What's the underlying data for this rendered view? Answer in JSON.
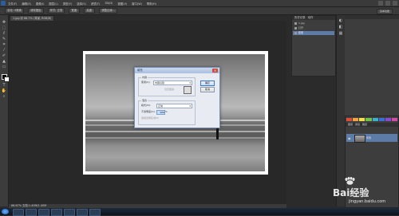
{
  "menubar": {
    "items": [
      "文件(F)",
      "编辑(E)",
      "图像(I)",
      "图层(L)",
      "类型(Y)",
      "选择(S)",
      "滤镜(T)",
      "3D(D)",
      "视图(V)",
      "窗口(W)",
      "帮助(H)"
    ]
  },
  "optionsbar": {
    "items": [
      "羽化: 0像素",
      "消除锯齿",
      "样式: 正常",
      "宽度:",
      "高度:",
      "调整边缘..."
    ],
    "workspace": "基本功能"
  },
  "document": {
    "tab_label": "1.jpg @ 66.7% (背景, RGB/8)",
    "status": "66.67%   文档:1.40M/1.40M"
  },
  "dialog": {
    "title": "填充",
    "content_group": "内容",
    "use_label": "使用(U):",
    "use_value": "内容识别",
    "custom_pattern_label": "自定图案:",
    "blend_group": "混合",
    "mode_label": "模式(M):",
    "mode_value": "正常",
    "opacity_label": "不透明度(O):",
    "opacity_value": "100",
    "opacity_unit": "%",
    "preserve_label": "保留透明区域(P)",
    "ok_label": "确定",
    "cancel_label": "取消",
    "close_glyph": "✕"
  },
  "history_panel": {
    "tabs": [
      "历史记录",
      "动作"
    ],
    "items": [
      {
        "label": "1.jpg"
      },
      {
        "label": "打开"
      },
      {
        "label": "套索"
      }
    ]
  },
  "layers_panel": {
    "tabs": [
      "图层",
      "通道",
      "路径"
    ],
    "layer_name": "背景"
  },
  "swatches": {
    "colors": [
      "#e24b3b",
      "#f3a33b",
      "#f4e04a",
      "#72c24b",
      "#3bb0c9",
      "#3b6fd4",
      "#8a4bd1",
      "#d14ba8"
    ]
  },
  "watermark": {
    "brand": "Bai",
    "brand2": "经验",
    "url": "jingyan.baidu.com"
  }
}
